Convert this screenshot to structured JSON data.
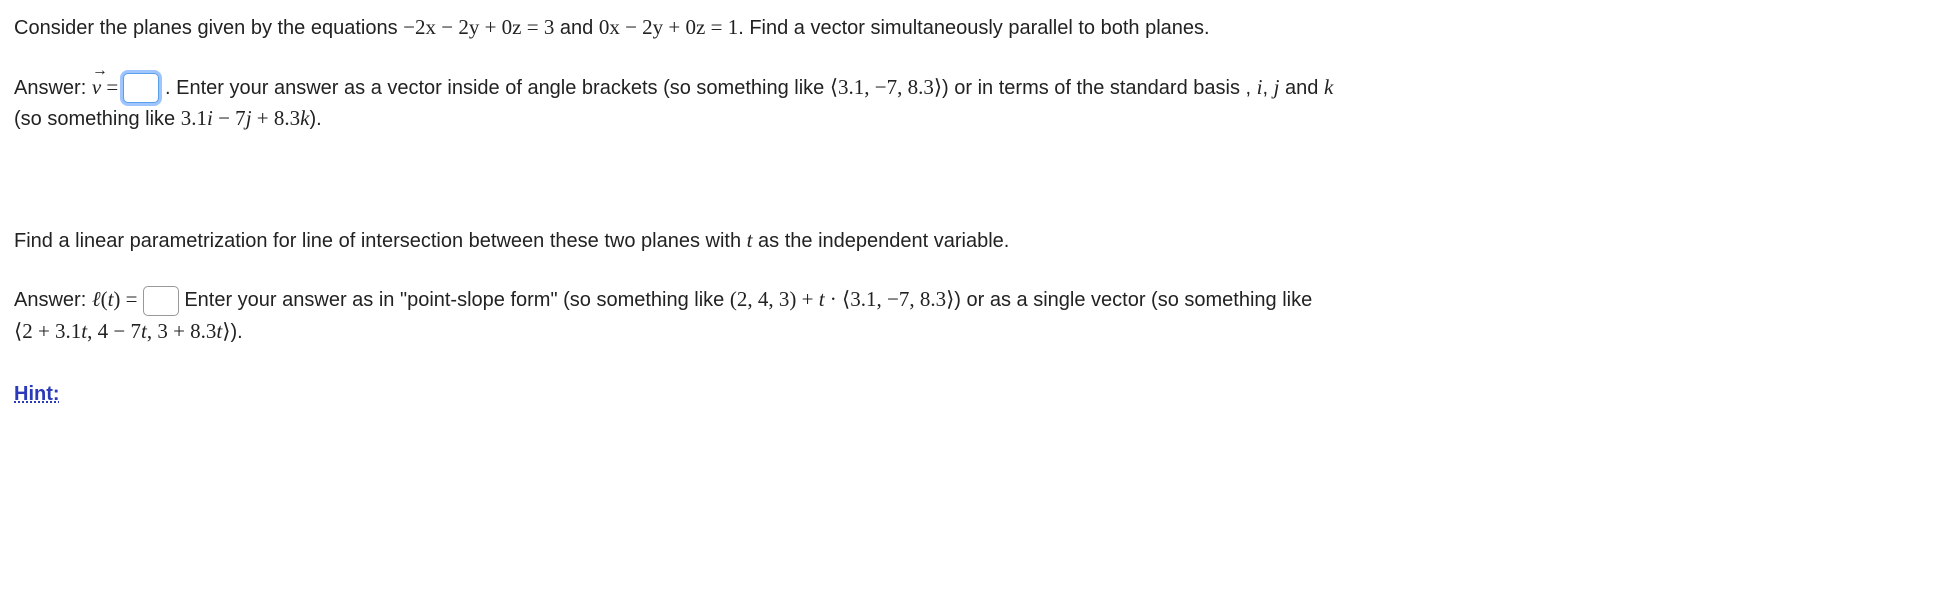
{
  "q1": {
    "prompt_a": "Consider the planes given by the equations ",
    "eq1": "−2x − 2y + 0z = 3",
    "mid": " and ",
    "eq2": "0x − 2y + 0z = 1",
    "prompt_b": ". Find a vector simultaneously parallel to both planes.",
    "answer_label_a": "Answer: ",
    "answer_vec": "v",
    "answer_eq": " = ",
    "instr_a": ". Enter your answer as a vector inside of angle brackets (so something like ",
    "example_vec": "⟨3.1, −7, 8.3⟩",
    "instr_b": ") or in terms of the standard basis , ",
    "basis_i": "i",
    "basis_sep1": ", ",
    "basis_j": "j",
    "instr_c": " and ",
    "basis_k": "k",
    "instr_d": "(so something like ",
    "example_ijk": "3.1i − 7j + 8.3k",
    "instr_e": ")."
  },
  "q2": {
    "prompt": "Find a linear parametrization for line of intersection between these two planes with ",
    "var_t": "t",
    "prompt_b": " as the independent variable.",
    "answer_label_a": "Answer: ",
    "ell_t": "ℓ(t)",
    "answer_eq": " = ",
    "instr_a": " Enter your answer as in \"point-slope form\" (so something like ",
    "example_ps": "(2, 4, 3) + t · ⟨3.1, −7, 8.3⟩",
    "instr_b": ") or as a single vector (so something like",
    "example_single": "⟨2 + 3.1t, 4 − 7t, 3 + 8.3t⟩",
    "instr_c": ")."
  },
  "hint": {
    "label": "Hint:"
  }
}
